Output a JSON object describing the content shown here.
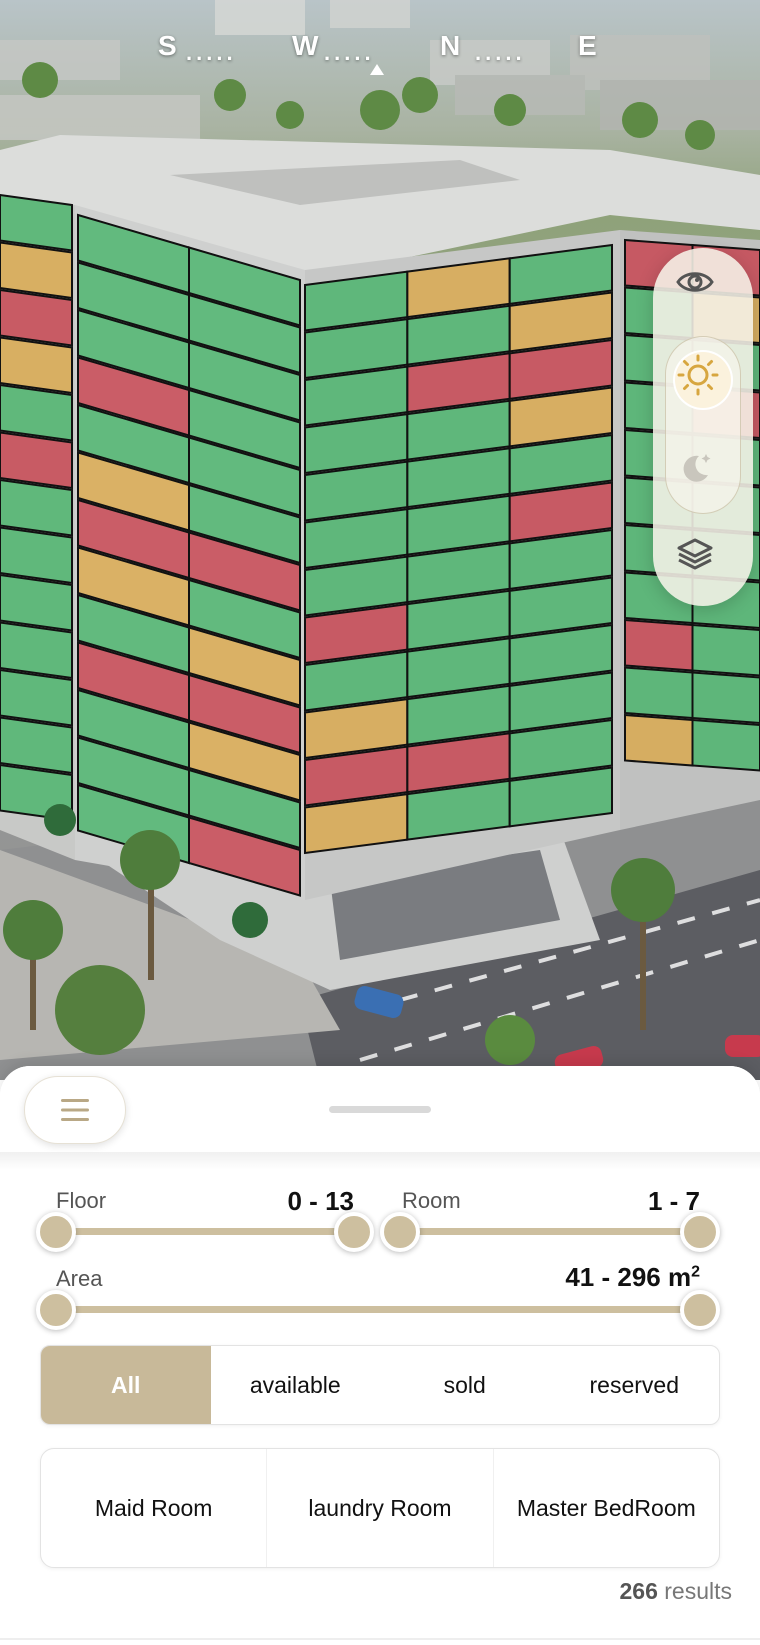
{
  "compass": {
    "south": "S",
    "west": "W",
    "north": "N",
    "east": "E",
    "dots": "....."
  },
  "viewer": {
    "status_colors": {
      "available": "#38b25e",
      "sold": "#c8313f",
      "reserved": "#dea53c"
    },
    "controls": [
      {
        "icon": "eye-icon"
      },
      {
        "icon": "sun-icon",
        "active": true
      },
      {
        "icon": "moon-icon",
        "active": false
      },
      {
        "icon": "layers-icon"
      }
    ]
  },
  "sheet": {
    "menu_icon": "hamburger-icon"
  },
  "filters": {
    "floor": {
      "label": "Floor",
      "value": "0 - 13",
      "min": 0,
      "max": 13
    },
    "room": {
      "label": "Room",
      "value": "1 - 7",
      "min": 1,
      "max": 7
    },
    "area": {
      "label": "Area",
      "value": "41 - 296 m",
      "unit_sup": "2",
      "min": 41,
      "max": 296
    }
  },
  "status_tabs": [
    {
      "label": "All",
      "active": true
    },
    {
      "label": "available",
      "active": false
    },
    {
      "label": "sold",
      "active": false
    },
    {
      "label": "reserved",
      "active": false
    }
  ],
  "features": [
    {
      "label": "Maid Room"
    },
    {
      "label": "laundry Room"
    },
    {
      "label": "Master BedRoom"
    }
  ],
  "results": {
    "count": "266",
    "label": "results"
  },
  "colors": {
    "accent": "#c8b999",
    "track": "#cdbf9f"
  }
}
